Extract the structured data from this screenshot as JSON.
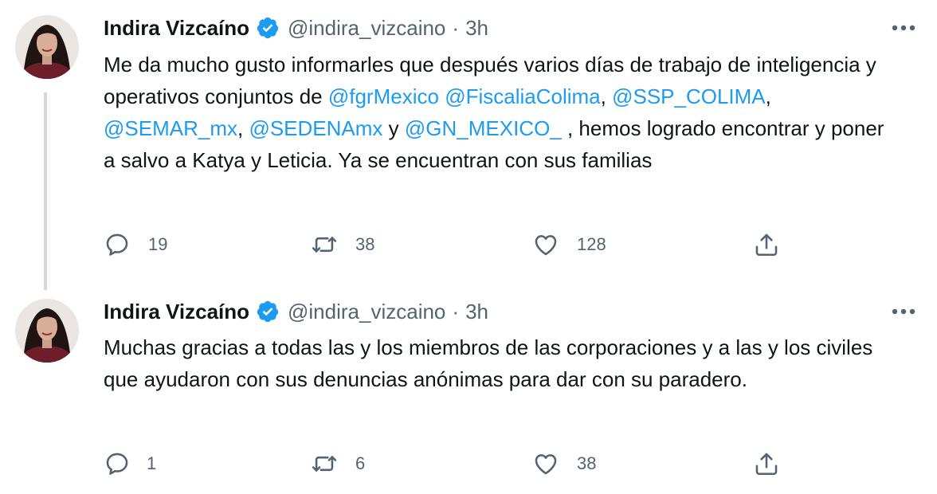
{
  "tweets": [
    {
      "author_name": "Indira Vizcaíno",
      "handle": "@indira_vizcaino",
      "separator": "·",
      "time": "3h",
      "text_segments": [
        {
          "text": "Me da mucho gusto informarles que  después varios días de trabajo de inteligencia y operativos conjuntos de ",
          "type": "plain"
        },
        {
          "text": "@fgrMexico",
          "type": "mention"
        },
        {
          "text": " ",
          "type": "plain"
        },
        {
          "text": "@FiscaliaColima",
          "type": "mention"
        },
        {
          "text": ", ",
          "type": "plain"
        },
        {
          "text": "@SSP_COLIMA",
          "type": "mention"
        },
        {
          "text": ", ",
          "type": "plain"
        },
        {
          "text": "@SEMAR_mx",
          "type": "mention"
        },
        {
          "text": ", ",
          "type": "plain"
        },
        {
          "text": "@SEDENAmx",
          "type": "mention"
        },
        {
          "text": " y ",
          "type": "plain"
        },
        {
          "text": "@GN_MEXICO_",
          "type": "mention"
        },
        {
          "text": " , hemos logrado encontrar y poner a salvo a Katya y Leticia. Ya se encuentran con sus familias",
          "type": "plain"
        }
      ],
      "replies": "19",
      "retweets": "38",
      "likes": "128"
    },
    {
      "author_name": "Indira Vizcaíno",
      "handle": "@indira_vizcaino",
      "separator": "·",
      "time": "3h",
      "text_segments": [
        {
          "text": "Muchas gracias a todas las y los miembros de las corporaciones y a las y los civiles  que ayudaron con sus denuncias anónimas para dar con su paradero.",
          "type": "plain"
        }
      ],
      "replies": "1",
      "retweets": "6",
      "likes": "38"
    }
  ],
  "icons": {
    "verified": "verified-badge-icon",
    "more": "more-dots-icon",
    "reply": "reply-bubble-icon",
    "retweet": "retweet-arrows-icon",
    "like": "heart-icon",
    "share": "share-upload-icon"
  },
  "colors": {
    "text": "#0f1419",
    "secondary": "#536471",
    "accent": "#1d9bf0",
    "thread_line": "#cfd9de"
  }
}
